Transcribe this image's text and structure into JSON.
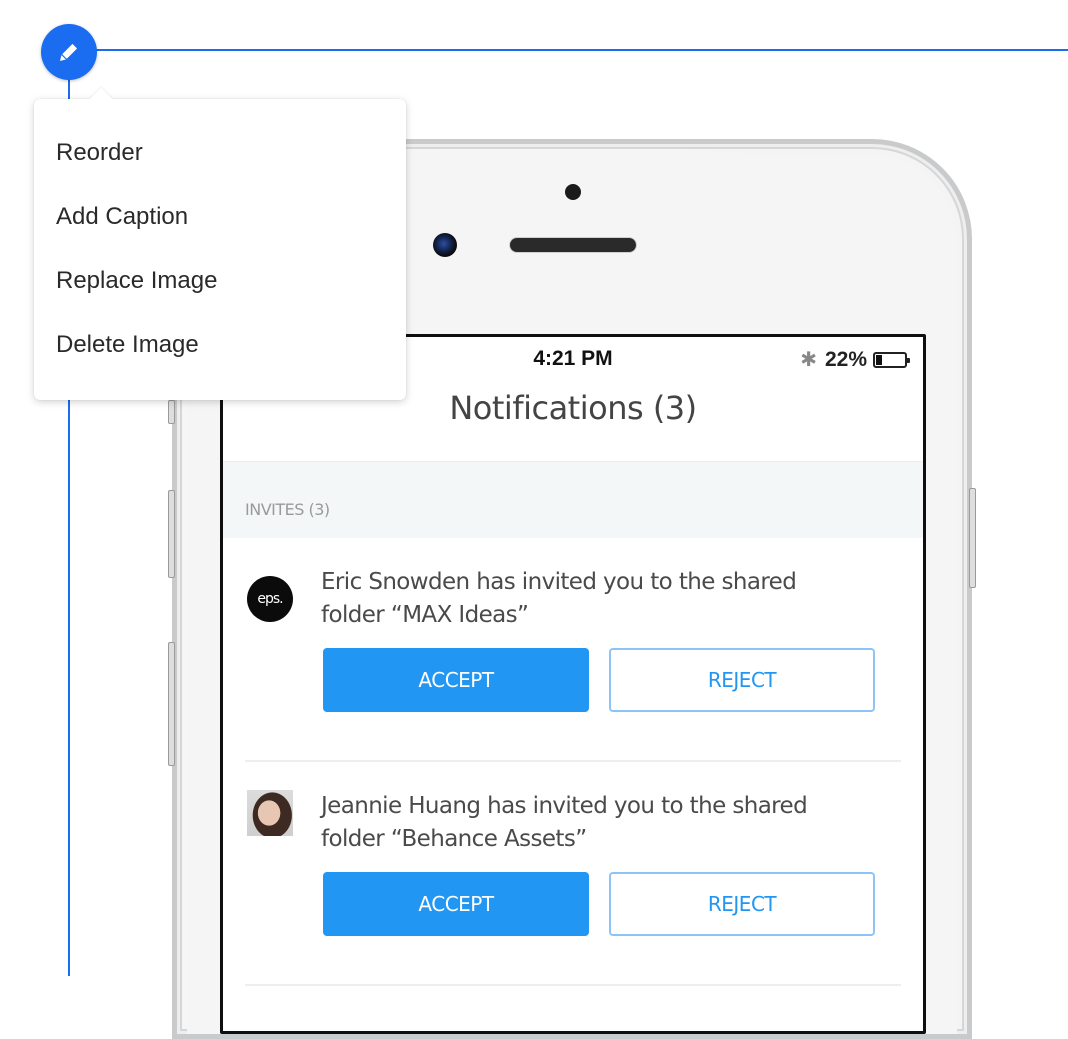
{
  "editor": {
    "edit_button_icon": "pencil-icon",
    "accent_color": "#1a6cf0",
    "menu": {
      "items": [
        {
          "label": "Reorder"
        },
        {
          "label": "Add Caption"
        },
        {
          "label": "Replace Image"
        },
        {
          "label": "Delete Image"
        }
      ]
    }
  },
  "phone": {
    "status_bar": {
      "time": "4:21 PM",
      "bluetooth_icon": "bluetooth-icon",
      "battery_percent_label": "22%",
      "battery_level": 0.22
    },
    "nav_title": "Notifications (3)",
    "section_header": "INVITES (3)",
    "invites": [
      {
        "avatar": "eps.",
        "message": "Eric Snowden has invited you to the shared folder “MAX Ideas”",
        "accept_label": "ACCEPT",
        "reject_label": "REJECT"
      },
      {
        "avatar": "photo",
        "message": "Jeannie Huang has invited you to the shared folder “Behance Assets”",
        "accept_label": "ACCEPT",
        "reject_label": "REJECT"
      }
    ],
    "accept_color": "#2196f3"
  }
}
